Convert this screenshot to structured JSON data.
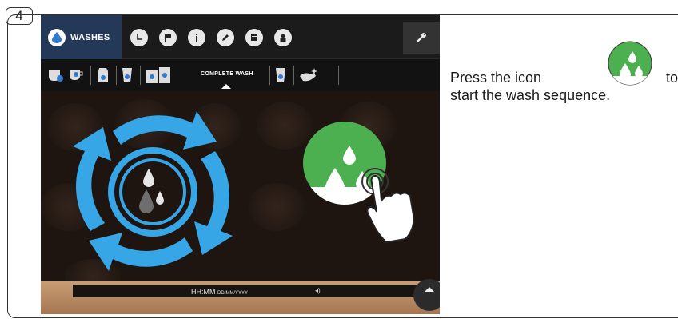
{
  "step": {
    "number": "4"
  },
  "app": {
    "tab_label": "WASHES",
    "top_icons": [
      "clock-icon",
      "flag-icon",
      "info-icon",
      "pencil-icon",
      "list-icon",
      "user-icon"
    ],
    "settings_icon": "wrench-icon",
    "active_subtab_label": "COMPLETE WASH",
    "status": {
      "time": "HH:MM",
      "date": "DD/MM/YYYY"
    },
    "colors": {
      "tab_blue": "#243957",
      "arrow_blue": "#36a6e6",
      "button_green": "#4caf50"
    }
  },
  "instruction": {
    "text_before": "Press the icon",
    "text_after_first": "to",
    "text_second_line": "start the wash sequence."
  }
}
